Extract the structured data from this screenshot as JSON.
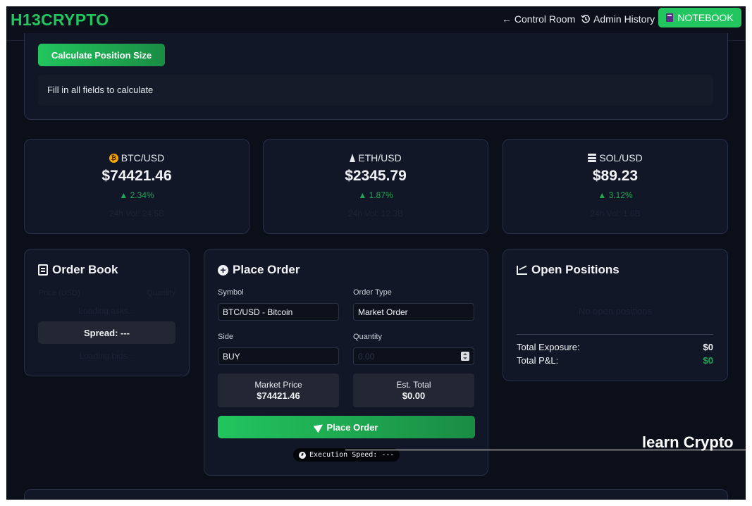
{
  "header": {
    "brand": "H13CRYPTO",
    "nav": {
      "control_room": "← Control Room",
      "admin_history": "Admin History",
      "notebook": "NOTEBOOK"
    }
  },
  "position_size": {
    "button_label": "Calculate Position Size",
    "result_text": "Fill in all fields to calculate"
  },
  "tickers": [
    {
      "pair": "BTC/USD",
      "price": "$74421.46",
      "change": "▲ 2.34%",
      "volume": "24h Vol: 24.5B",
      "icon": "bitcoin-icon"
    },
    {
      "pair": "ETH/USD",
      "price": "$2345.79",
      "change": "▲ 1.87%",
      "volume": "24h Vol: 12.3B",
      "icon": "ethereum-icon"
    },
    {
      "pair": "SOL/USD",
      "price": "$89.23",
      "change": "▲ 3.12%",
      "volume": "24h Vol: 1.8B",
      "icon": "coins-icon"
    }
  ],
  "colors": {
    "accent": "#22c55e",
    "positive": "#22a755",
    "panel_bg": "#111726",
    "page_bg": "#0a0f1a"
  },
  "order_book": {
    "title": "Order Book",
    "price_header": "Price (USD)",
    "quantity_header": "Quantity",
    "asks_loading": "Loading asks...",
    "spread": "Spread: ---",
    "bids_loading": "Loading bids..."
  },
  "place_order": {
    "title": "Place Order",
    "symbol_label": "Symbol",
    "symbol_value": "BTC/USD - Bitcoin",
    "order_type_label": "Order Type",
    "order_type_value": "Market Order",
    "side_label": "Side",
    "side_value": "BUY",
    "quantity_label": "Quantity",
    "quantity_placeholder": "0.00",
    "market_price_label": "Market Price",
    "market_price_value": "$74421.46",
    "est_total_label": "Est. Total",
    "est_total_value": "$0.00",
    "submit_label": "Place Order",
    "execution_speed": "Execution Speed: ---"
  },
  "open_positions": {
    "title": "Open Positions",
    "empty_text": "No open positions",
    "total_exposure_label": "Total Exposure:",
    "total_exposure_value": "$0",
    "total_pnl_label": "Total P&L:",
    "total_pnl_value": "$0"
  },
  "overlay": {
    "learn_text": "learn Crypto"
  }
}
